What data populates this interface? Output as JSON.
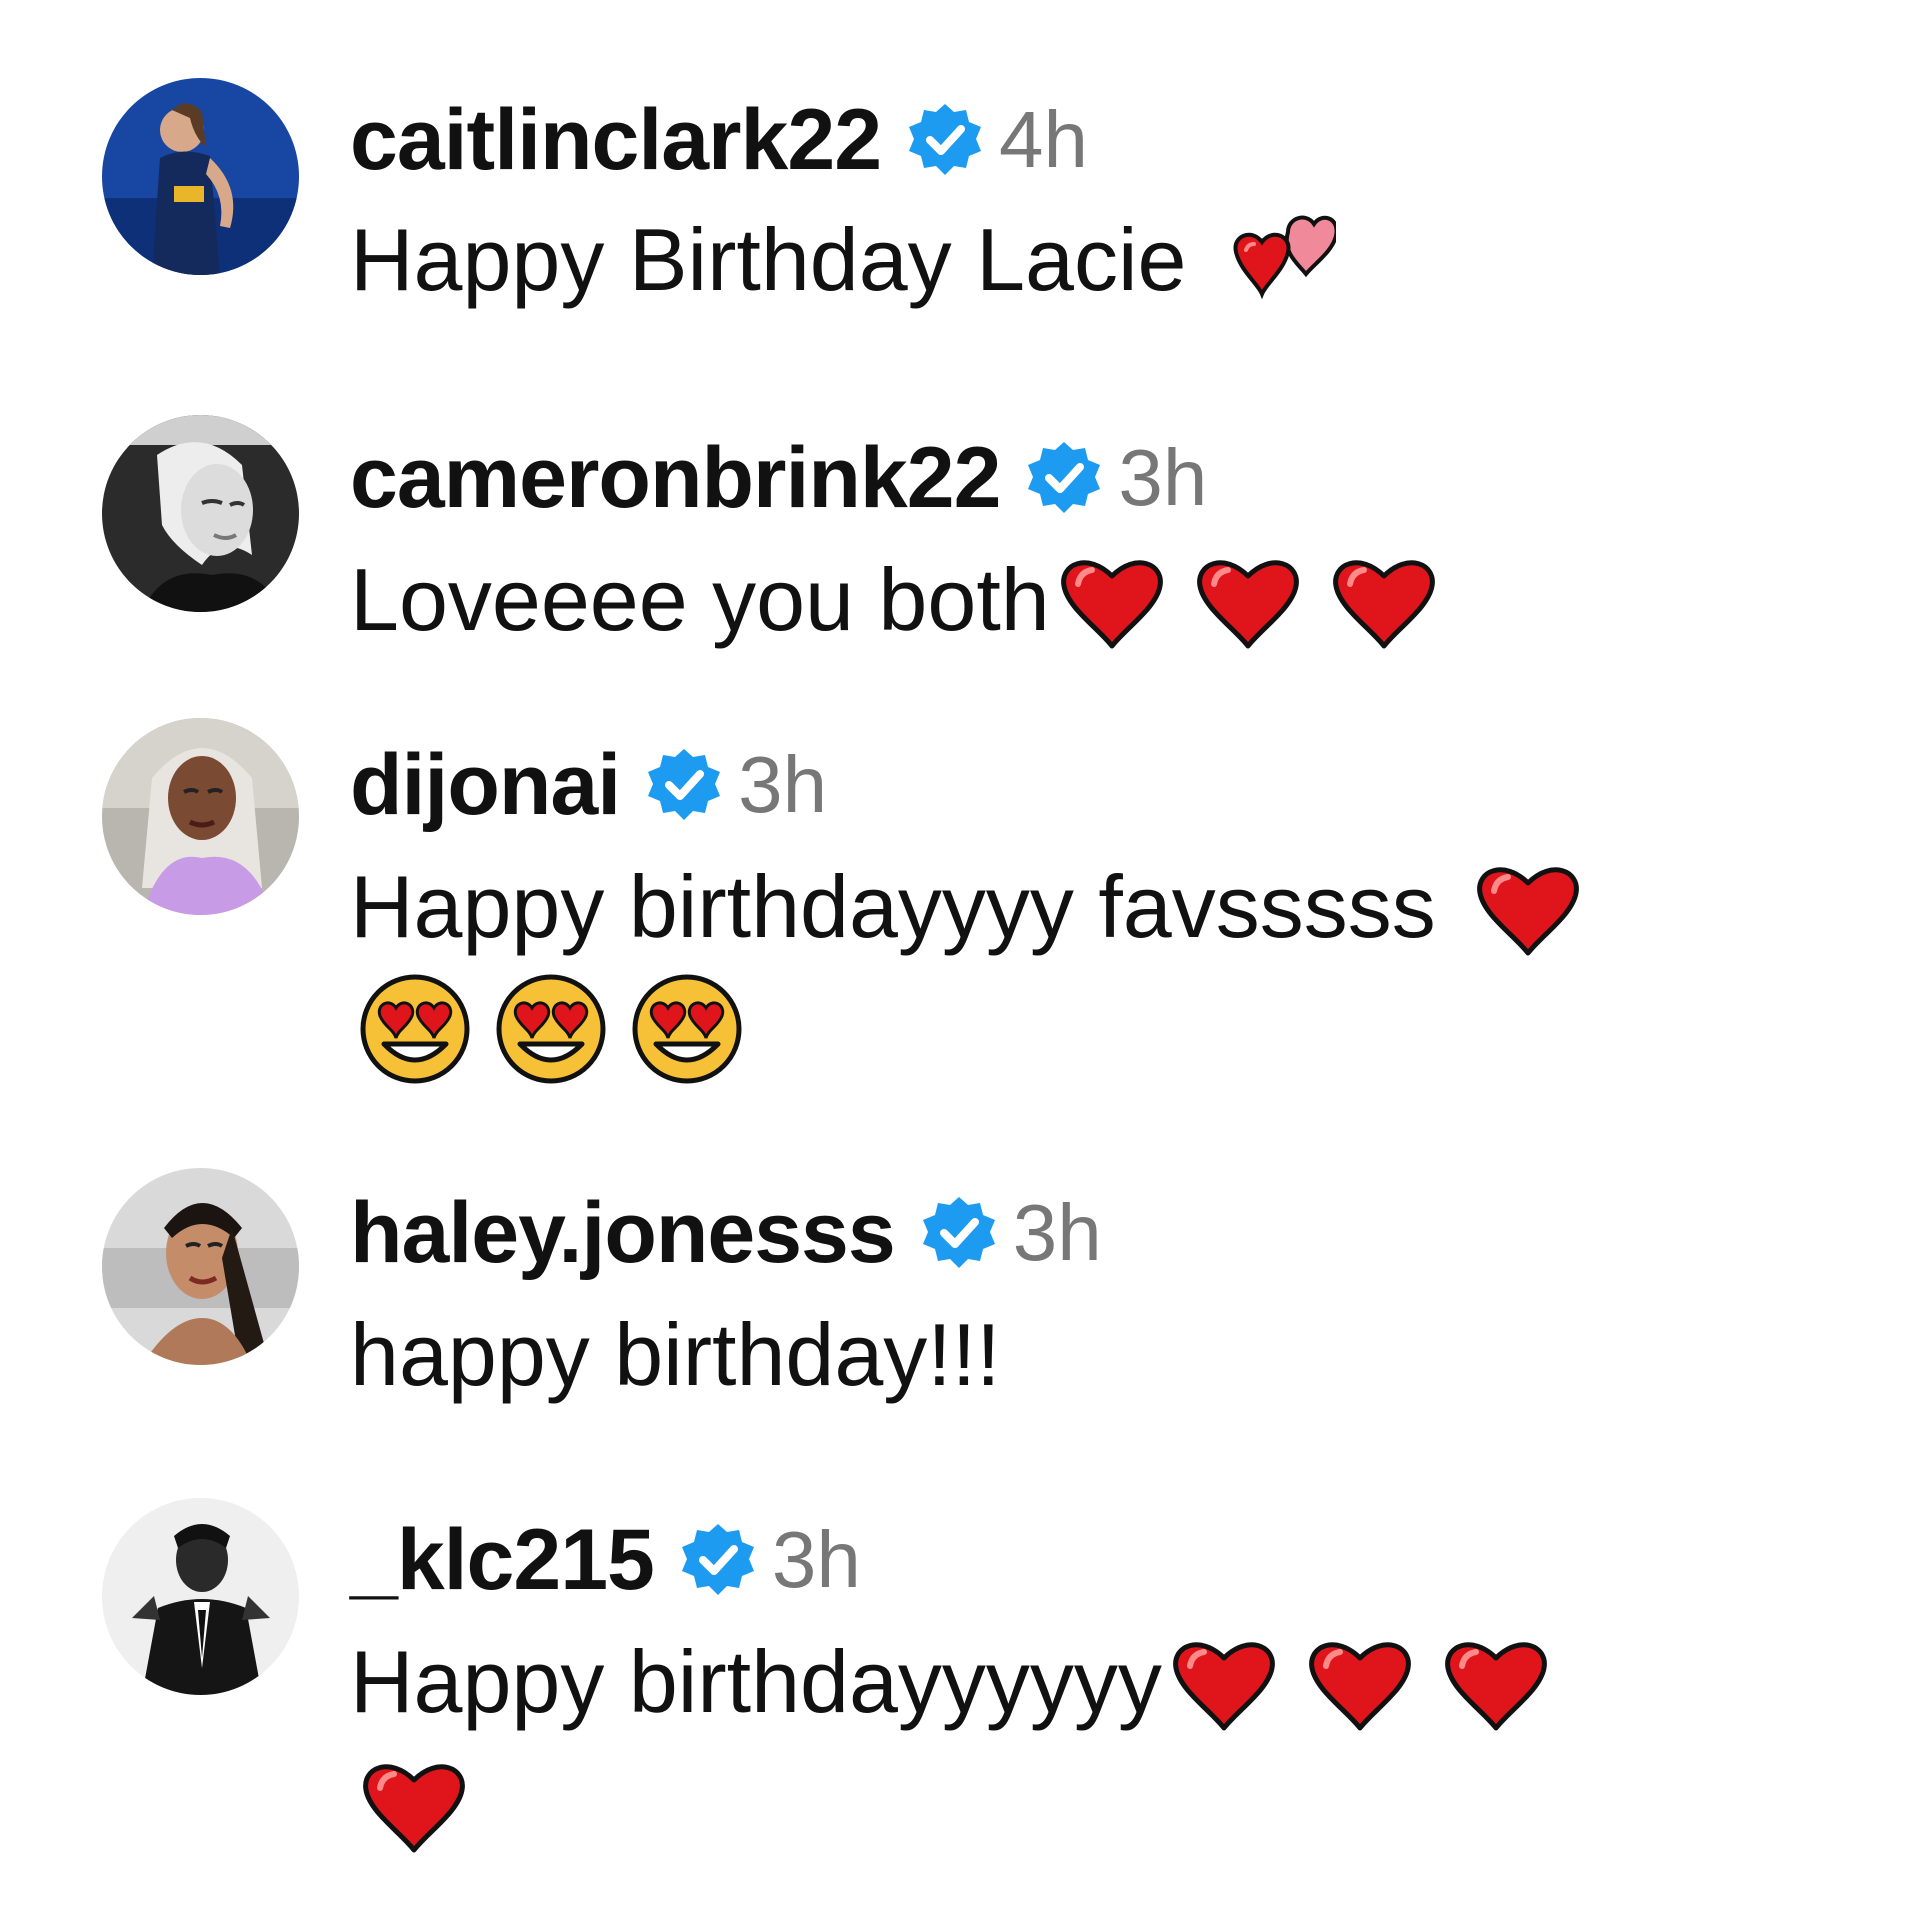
{
  "comments": [
    {
      "username": "caitlinclark22",
      "time": "4h",
      "text": "Happy Birthday Lacie",
      "avatar_icon": "profile-photo-blue-background",
      "emojis_line1": [
        "two-hearts-icon"
      ],
      "emojis_line2": []
    },
    {
      "username": "cameronbrink22",
      "time": "3h",
      "text": "Loveeee you both",
      "avatar_icon": "profile-photo-black-and-white",
      "emojis_line1": [
        "red-heart-icon",
        "red-heart-icon",
        "red-heart-icon"
      ],
      "emojis_line2": []
    },
    {
      "username": "dijonai",
      "time": "3h",
      "text": "Happy birthdayyyy favsssss",
      "avatar_icon": "profile-photo-blonde",
      "emojis_line1": [
        "red-heart-icon"
      ],
      "emojis_line2": [
        "heart-eyes-icon",
        "heart-eyes-icon",
        "heart-eyes-icon"
      ]
    },
    {
      "username": "haley.jonesss",
      "time": "3h",
      "text": "happy birthday!!!",
      "avatar_icon": "profile-photo-braids",
      "emojis_line1": [],
      "emojis_line2": []
    },
    {
      "username": "_klc215",
      "time": "3h",
      "text": "Happy birthdayyyyyy",
      "avatar_icon": "profile-photo-suit-black-and-white",
      "emojis_line1": [
        "red-heart-icon",
        "red-heart-icon",
        "red-heart-icon"
      ],
      "emojis_line2": [
        "red-heart-icon"
      ]
    }
  ],
  "colors": {
    "verified_badge": "#1D9BF0",
    "timestamp": "#777777",
    "heart": "#E0151C",
    "emoji_face": "#F7C137"
  }
}
